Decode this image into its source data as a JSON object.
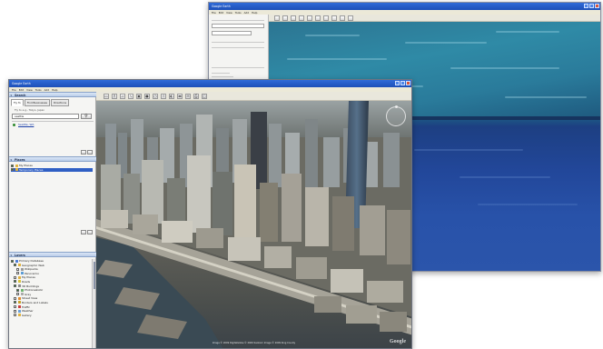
{
  "back_window": {
    "title": "Google Earth",
    "menu": [
      "File",
      "Edit",
      "View",
      "Tools",
      "Add",
      "Help"
    ]
  },
  "front_window": {
    "title": "Google Earth",
    "menu": [
      "File",
      "Edit",
      "View",
      "Tools",
      "Add",
      "Help"
    ],
    "search": {
      "header": "Search",
      "tabs": [
        "Fly To",
        "Find Businesses",
        "Directions"
      ],
      "hint": "Fly to e.g., Tokyo, Japan",
      "query": "seattle",
      "result": "Seattle, WA"
    },
    "places": {
      "header": "Places",
      "items": [
        "My Places",
        "Temporary Places"
      ]
    },
    "layers": {
      "header": "Layers",
      "items": [
        "Primary Database",
        "Geographic Web",
        "Wikipedia",
        "Panoramio",
        "My Places",
        "Roads",
        "3D Buildings",
        "Photorealistic",
        "Gray",
        "Street View",
        "Borders and Labels",
        "Traffic",
        "Weather",
        "Gallery"
      ]
    },
    "view": {
      "attribution": "Image © 2009 DigitalGlobe  © 2009 Sanborn  Image © 2009 King County",
      "logo": "Google"
    }
  },
  "colors": {
    "titlebar": "#1d4fb8",
    "ocean": "#22479a",
    "sea_surface": "#2e8aa8",
    "selection": "#2f5fc4"
  }
}
